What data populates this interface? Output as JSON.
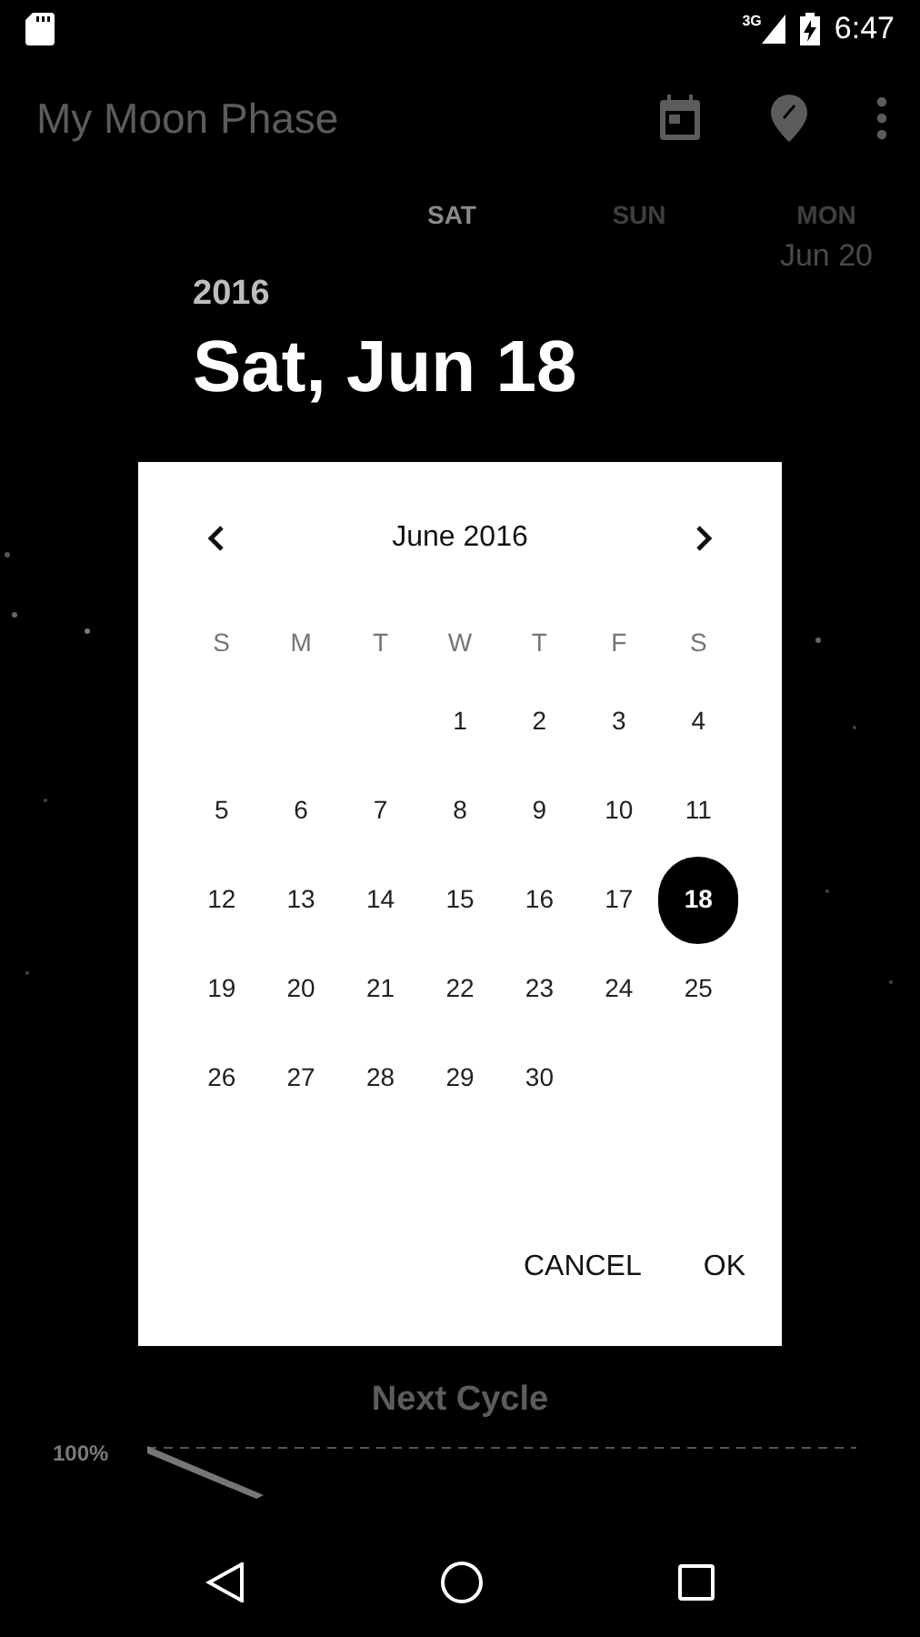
{
  "status_bar": {
    "network": "3G",
    "time": "6:47"
  },
  "app_bar": {
    "title": "My Moon Phase"
  },
  "day_strip": [
    {
      "day": "SAT",
      "selected": true
    },
    {
      "day": "SUN",
      "selected": false
    },
    {
      "day": "MON",
      "date": "Jun 20",
      "selected": false
    }
  ],
  "next_cycle": {
    "title": "Next Cycle",
    "axis_label": "100%"
  },
  "date_picker": {
    "year": "2016",
    "date": "Sat, Jun 18",
    "month": "June 2016",
    "weekdays": [
      "S",
      "M",
      "T",
      "W",
      "T",
      "F",
      "S"
    ],
    "weeks": [
      {
        "kind": "first",
        "days": [
          {
            "label": "1",
            "selected": false
          },
          {
            "label": "2",
            "selected": false
          },
          {
            "label": "3",
            "selected": false
          },
          {
            "label": "4",
            "selected": false
          }
        ]
      },
      {
        "kind": "full",
        "days": [
          {
            "label": "5",
            "selected": false
          },
          {
            "label": "6",
            "selected": false
          },
          {
            "label": "7",
            "selected": false
          },
          {
            "label": "8",
            "selected": false
          },
          {
            "label": "9",
            "selected": false
          },
          {
            "label": "10",
            "selected": false
          },
          {
            "label": "11",
            "selected": false
          }
        ]
      },
      {
        "kind": "full",
        "days": [
          {
            "label": "12",
            "selected": false
          },
          {
            "label": "13",
            "selected": false
          },
          {
            "label": "14",
            "selected": false
          },
          {
            "label": "15",
            "selected": false
          },
          {
            "label": "16",
            "selected": false
          },
          {
            "label": "17",
            "selected": false
          },
          {
            "label": "18",
            "selected": true
          }
        ]
      },
      {
        "kind": "full",
        "days": [
          {
            "label": "19",
            "selected": false
          },
          {
            "label": "20",
            "selected": false
          },
          {
            "label": "21",
            "selected": false
          },
          {
            "label": "22",
            "selected": false
          },
          {
            "label": "23",
            "selected": false
          },
          {
            "label": "24",
            "selected": false
          },
          {
            "label": "25",
            "selected": false
          }
        ]
      },
      {
        "kind": "last",
        "days": [
          {
            "label": "26",
            "selected": false
          },
          {
            "label": "27",
            "selected": false
          },
          {
            "label": "28",
            "selected": false
          },
          {
            "label": "29",
            "selected": false
          },
          {
            "label": "30",
            "selected": false
          }
        ]
      }
    ],
    "buttons": [
      {
        "label": "CANCEL"
      },
      {
        "label": "OK"
      }
    ]
  }
}
